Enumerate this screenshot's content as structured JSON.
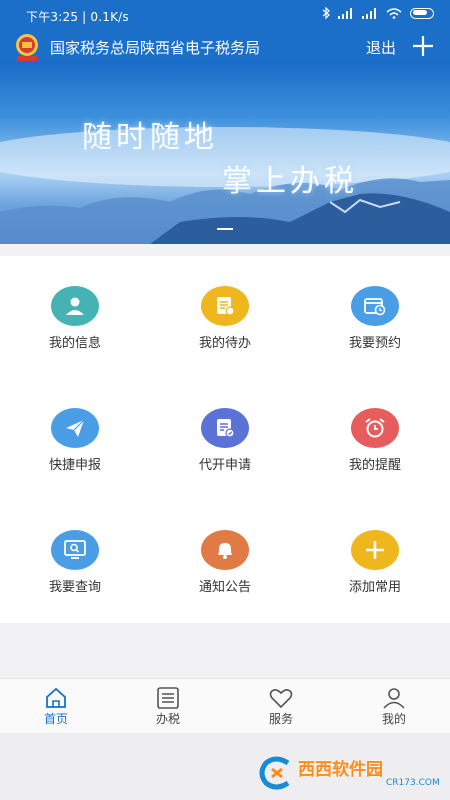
{
  "status_bar": {
    "time": "下午3:25 | 0.1K/s"
  },
  "app_bar": {
    "title": "国家税务总局陕西省电子税务局",
    "logout_label": "退出"
  },
  "banner": {
    "slogan_line1": "随时随地",
    "slogan_line2": "掌上办税"
  },
  "menu": [
    {
      "label": "我的信息",
      "icon": "user-card-icon",
      "color": "#45b3b3"
    },
    {
      "label": "我的待办",
      "icon": "todo-list-icon",
      "color": "#f0b61e"
    },
    {
      "label": "我要预约",
      "icon": "calendar-clock-icon",
      "color": "#4a9ee6"
    },
    {
      "label": "快捷申报",
      "icon": "paper-plane-icon",
      "color": "#4a9ee6"
    },
    {
      "label": "代开申请",
      "icon": "document-edit-icon",
      "color": "#5b73d6"
    },
    {
      "label": "我的提醒",
      "icon": "alarm-clock-icon",
      "color": "#e75c5c"
    },
    {
      "label": "我要查询",
      "icon": "screen-search-icon",
      "color": "#4a9ee6"
    },
    {
      "label": "通知公告",
      "icon": "bell-icon",
      "color": "#e07b45"
    },
    {
      "label": "添加常用",
      "icon": "plus-icon",
      "color": "#f0b61e"
    }
  ],
  "tabs": [
    {
      "label": "首页",
      "icon": "home-icon",
      "active": true
    },
    {
      "label": "办税",
      "icon": "list-icon",
      "active": false
    },
    {
      "label": "服务",
      "icon": "heart-icon",
      "active": false
    },
    {
      "label": "我的",
      "icon": "person-icon",
      "active": false
    }
  ],
  "watermark": {
    "text": "西西软件园",
    "sub": "CR173.COM"
  },
  "colors": {
    "primary": "#1c6fc8",
    "tab_active": "#1c6fc8"
  }
}
